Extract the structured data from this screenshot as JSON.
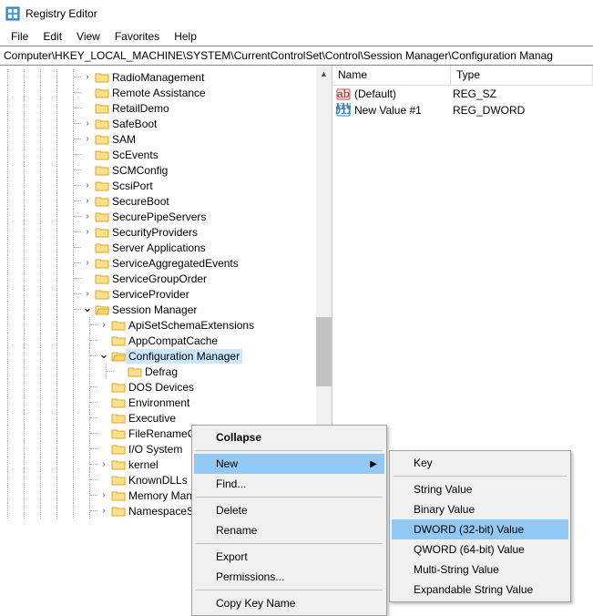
{
  "title": "Registry Editor",
  "menus": {
    "file": "File",
    "edit": "Edit",
    "view": "View",
    "favorites": "Favorites",
    "help": "Help"
  },
  "address": "Computer\\HKEY_LOCAL_MACHINE\\SYSTEM\\CurrentControlSet\\Control\\Session Manager\\Configuration Manag",
  "tree": {
    "items": [
      {
        "label": "RadioManagement",
        "indent": 5,
        "exp": "closed"
      },
      {
        "label": "Remote Assistance",
        "indent": 5,
        "exp": "none"
      },
      {
        "label": "RetailDemo",
        "indent": 5,
        "exp": "none"
      },
      {
        "label": "SafeBoot",
        "indent": 5,
        "exp": "closed"
      },
      {
        "label": "SAM",
        "indent": 5,
        "exp": "closed"
      },
      {
        "label": "ScEvents",
        "indent": 5,
        "exp": "none"
      },
      {
        "label": "SCMConfig",
        "indent": 5,
        "exp": "none"
      },
      {
        "label": "ScsiPort",
        "indent": 5,
        "exp": "closed"
      },
      {
        "label": "SecureBoot",
        "indent": 5,
        "exp": "closed"
      },
      {
        "label": "SecurePipeServers",
        "indent": 5,
        "exp": "closed"
      },
      {
        "label": "SecurityProviders",
        "indent": 5,
        "exp": "closed"
      },
      {
        "label": "Server Applications",
        "indent": 5,
        "exp": "none"
      },
      {
        "label": "ServiceAggregatedEvents",
        "indent": 5,
        "exp": "closed"
      },
      {
        "label": "ServiceGroupOrder",
        "indent": 5,
        "exp": "none"
      },
      {
        "label": "ServiceProvider",
        "indent": 5,
        "exp": "closed"
      },
      {
        "label": "Session Manager",
        "indent": 5,
        "exp": "open"
      },
      {
        "label": "ApiSetSchemaExtensions",
        "indent": 6,
        "exp": "closed"
      },
      {
        "label": "AppCompatCache",
        "indent": 6,
        "exp": "none"
      },
      {
        "label": "Configuration Manager",
        "indent": 6,
        "exp": "open",
        "selected": true
      },
      {
        "label": "Defrag",
        "indent": 7,
        "exp": "none"
      },
      {
        "label": "DOS Devices",
        "indent": 6,
        "exp": "none"
      },
      {
        "label": "Environment",
        "indent": 6,
        "exp": "none"
      },
      {
        "label": "Executive",
        "indent": 6,
        "exp": "none"
      },
      {
        "label": "FileRenameOper",
        "indent": 6,
        "exp": "none"
      },
      {
        "label": "I/O System",
        "indent": 6,
        "exp": "none"
      },
      {
        "label": "kernel",
        "indent": 6,
        "exp": "closed"
      },
      {
        "label": "KnownDLLs",
        "indent": 6,
        "exp": "none"
      },
      {
        "label": "Memory Manage",
        "indent": 6,
        "exp": "closed"
      },
      {
        "label": "NamespaceSepa",
        "indent": 6,
        "exp": "closed"
      }
    ]
  },
  "values": {
    "header_name": "Name",
    "header_type": "Type",
    "rows": [
      {
        "icon": "string",
        "name": "(Default)",
        "type": "REG_SZ"
      },
      {
        "icon": "binary",
        "name": "New Value #1",
        "type": "REG_DWORD"
      }
    ]
  },
  "ctx1": {
    "collapse": "Collapse",
    "new": "New",
    "find": "Find...",
    "delete": "Delete",
    "rename": "Rename",
    "export": "Export",
    "permissions": "Permissions...",
    "copykey": "Copy Key Name"
  },
  "ctx2": {
    "key": "Key",
    "string": "String Value",
    "binary": "Binary Value",
    "dword": "DWORD (32-bit) Value",
    "qword": "QWORD (64-bit) Value",
    "multi": "Multi-String Value",
    "expand": "Expandable String Value"
  }
}
